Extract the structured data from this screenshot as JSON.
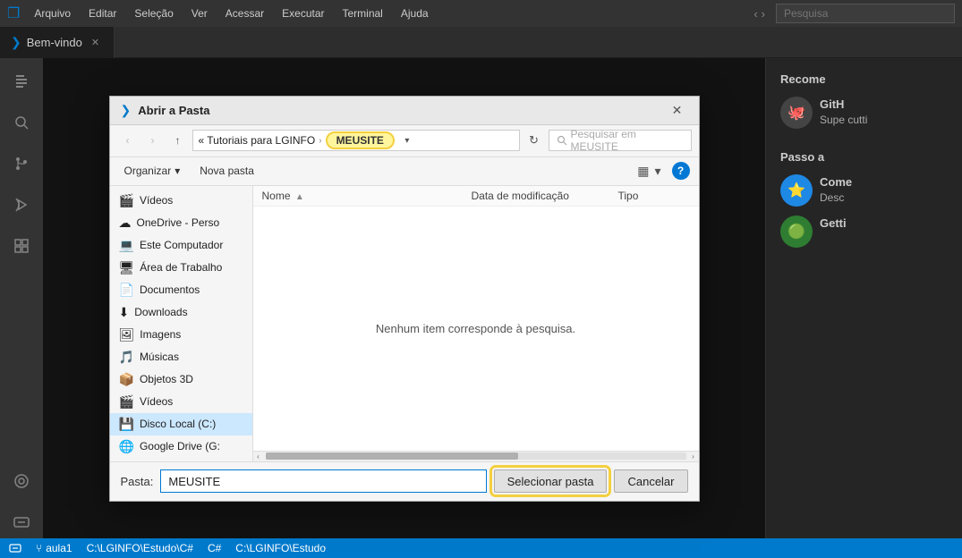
{
  "menubar": {
    "items": [
      "Arquivo",
      "Editar",
      "Seleção",
      "Ver",
      "Acessar",
      "Executar",
      "Terminal",
      "Ajuda"
    ],
    "search_placeholder": "Pesquisa"
  },
  "tab": {
    "label": "Bem-vindo",
    "icon": "❯"
  },
  "activity_bar": {
    "icons": [
      {
        "name": "files-icon",
        "symbol": "⎘"
      },
      {
        "name": "search-icon",
        "symbol": "🔍"
      },
      {
        "name": "source-control-icon",
        "symbol": "⑂"
      },
      {
        "name": "debug-icon",
        "symbol": "▷"
      },
      {
        "name": "extensions-icon",
        "symbol": "⊞"
      },
      {
        "name": "github-icon",
        "symbol": "⬡"
      },
      {
        "name": "remote-icon",
        "symbol": "⊂"
      }
    ]
  },
  "right_panel": {
    "title": "Recome",
    "items": [
      {
        "icon": "🐙",
        "name": "GitH",
        "desc": "Supe\ncutti"
      },
      {
        "icon": "⭐",
        "name": "Come",
        "desc": "Desc"
      },
      {
        "icon": "🟢",
        "name": "Getti",
        "desc": ""
      }
    ]
  },
  "status_bar": {
    "items": [
      "aula1",
      "C:\\LGINFO\\Estudo\\C#",
      "C#",
      "C:\\LGINFO\\Estudo"
    ]
  },
  "dialog": {
    "title": "Abrir a Pasta",
    "nav": {
      "back_disabled": true,
      "forward_disabled": true,
      "up_label": "↑",
      "breadcrumb": "« Tutoriais para LGINFO",
      "current_folder": "MEUSITE",
      "search_placeholder": "Pesquisar em MEUSITE",
      "refresh_icon": "↻"
    },
    "toolbar": {
      "organize_label": "Organizar",
      "new_folder_label": "Nova pasta",
      "view_icon": "▦",
      "help_label": "?"
    },
    "sidebar": {
      "items": [
        {
          "icon": "🎬",
          "label": "Vídeos"
        },
        {
          "icon": "☁",
          "label": "OneDrive - Perso"
        },
        {
          "icon": "💻",
          "label": "Este Computador"
        },
        {
          "icon": "🖥",
          "label": "Área de Trabalho"
        },
        {
          "icon": "📄",
          "label": "Documentos"
        },
        {
          "icon": "⬇",
          "label": "Downloads"
        },
        {
          "icon": "🖼",
          "label": "Imagens"
        },
        {
          "icon": "🎵",
          "label": "Músicas"
        },
        {
          "icon": "📦",
          "label": "Objetos 3D"
        },
        {
          "icon": "🎬",
          "label": "Vídeos"
        },
        {
          "icon": "💾",
          "label": "Disco Local (C:)"
        },
        {
          "icon": "🌐",
          "label": "Google Drive (G:"
        }
      ]
    },
    "files": {
      "headers": [
        "Nome",
        "Data de modificação",
        "Tipo"
      ],
      "empty_message": "Nenhum item corresponde à pesquisa.",
      "sort_arrow": "▲"
    },
    "footer": {
      "folder_label": "Pasta:",
      "folder_value": "MEUSITE",
      "select_label": "Selecionar pasta",
      "cancel_label": "Cancelar"
    }
  }
}
